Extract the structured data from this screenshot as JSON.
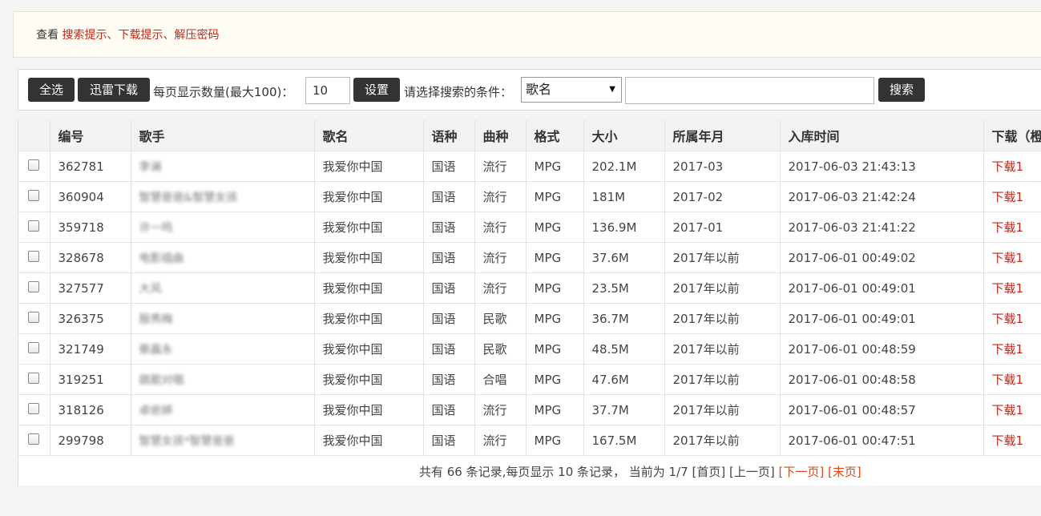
{
  "notice": {
    "prefix": "查看",
    "links": [
      "搜索提示",
      "下载提示",
      "解压密码"
    ],
    "separator": "、"
  },
  "toolbar": {
    "select_all_label": "全选",
    "thunder_download_label": "迅雷下载",
    "per_page_label": "每页显示数量(最大100)：",
    "per_page_value": "10",
    "set_label": "设置",
    "condition_label": "请选择搜索的条件：",
    "condition_selected": "歌名",
    "search_value": "",
    "search_label": "搜索"
  },
  "table": {
    "headers": [
      "编号",
      "歌手",
      "歌名",
      "语种",
      "曲种",
      "格式",
      "大小",
      "所属年月",
      "入库时间",
      "下载（橙"
    ],
    "rows": [
      {
        "id": "362781",
        "singer": "李澜",
        "title": "我爱你中国",
        "lang": "国语",
        "genre": "流行",
        "format": "MPG",
        "size": "202.1M",
        "month": "2017-03",
        "added": "2017-06-03 21:43:13",
        "download": "下载1"
      },
      {
        "id": "360904",
        "singer": "智慧爸爸&智慧女孩",
        "title": "我爱你中国",
        "lang": "国语",
        "genre": "流行",
        "format": "MPG",
        "size": "181M",
        "month": "2017-02",
        "added": "2017-06-03 21:42:24",
        "download": "下载1"
      },
      {
        "id": "359718",
        "singer": "许一鸣",
        "title": "我爱你中国",
        "lang": "国语",
        "genre": "流行",
        "format": "MPG",
        "size": "136.9M",
        "month": "2017-01",
        "added": "2017-06-03 21:41:22",
        "download": "下载1"
      },
      {
        "id": "328678",
        "singer": "电影插曲",
        "title": "我爱你中国",
        "lang": "国语",
        "genre": "流行",
        "format": "MPG",
        "size": "37.6M",
        "month": "2017年以前",
        "added": "2017-06-01 00:49:02",
        "download": "下载1"
      },
      {
        "id": "327577",
        "singer": "大风",
        "title": "我爱你中国",
        "lang": "国语",
        "genre": "流行",
        "format": "MPG",
        "size": "23.5M",
        "month": "2017年以前",
        "added": "2017-06-01 00:49:01",
        "download": "下载1"
      },
      {
        "id": "326375",
        "singer": "殷秀梅",
        "title": "我爱你中国",
        "lang": "国语",
        "genre": "民歌",
        "format": "MPG",
        "size": "36.7M",
        "month": "2017年以前",
        "added": "2017-06-01 00:49:01",
        "download": "下载1"
      },
      {
        "id": "321749",
        "singer": "蔡晨永",
        "title": "我爱你中国",
        "lang": "国语",
        "genre": "民歌",
        "format": "MPG",
        "size": "48.5M",
        "month": "2017年以前",
        "added": "2017-06-01 00:48:59",
        "download": "下载1"
      },
      {
        "id": "319251",
        "singer": "跳歌对唱",
        "title": "我爱你中国",
        "lang": "国语",
        "genre": "合唱",
        "format": "MPG",
        "size": "47.6M",
        "month": "2017年以前",
        "added": "2017-06-01 00:48:58",
        "download": "下载1"
      },
      {
        "id": "318126",
        "singer": "卓依婷",
        "title": "我爱你中国",
        "lang": "国语",
        "genre": "流行",
        "format": "MPG",
        "size": "37.7M",
        "month": "2017年以前",
        "added": "2017-06-01 00:48:57",
        "download": "下载1"
      },
      {
        "id": "299798",
        "singer": "智慧女孩*智慧爸爸",
        "title": "我爱你中国",
        "lang": "国语",
        "genre": "流行",
        "format": "MPG",
        "size": "167.5M",
        "month": "2017年以前",
        "added": "2017-06-01 00:47:51",
        "download": "下载1"
      }
    ]
  },
  "pager": {
    "summary": "共有 66 条记录,每页显示 10 条记录， 当前为 1/7",
    "first": "[首页]",
    "prev": "[上一页]",
    "next": "[下一页]",
    "last": "[末页]"
  },
  "colors": {
    "accent_red": "#c0281d",
    "button_dark": "#333333",
    "pager_link": "#d94a1e"
  }
}
